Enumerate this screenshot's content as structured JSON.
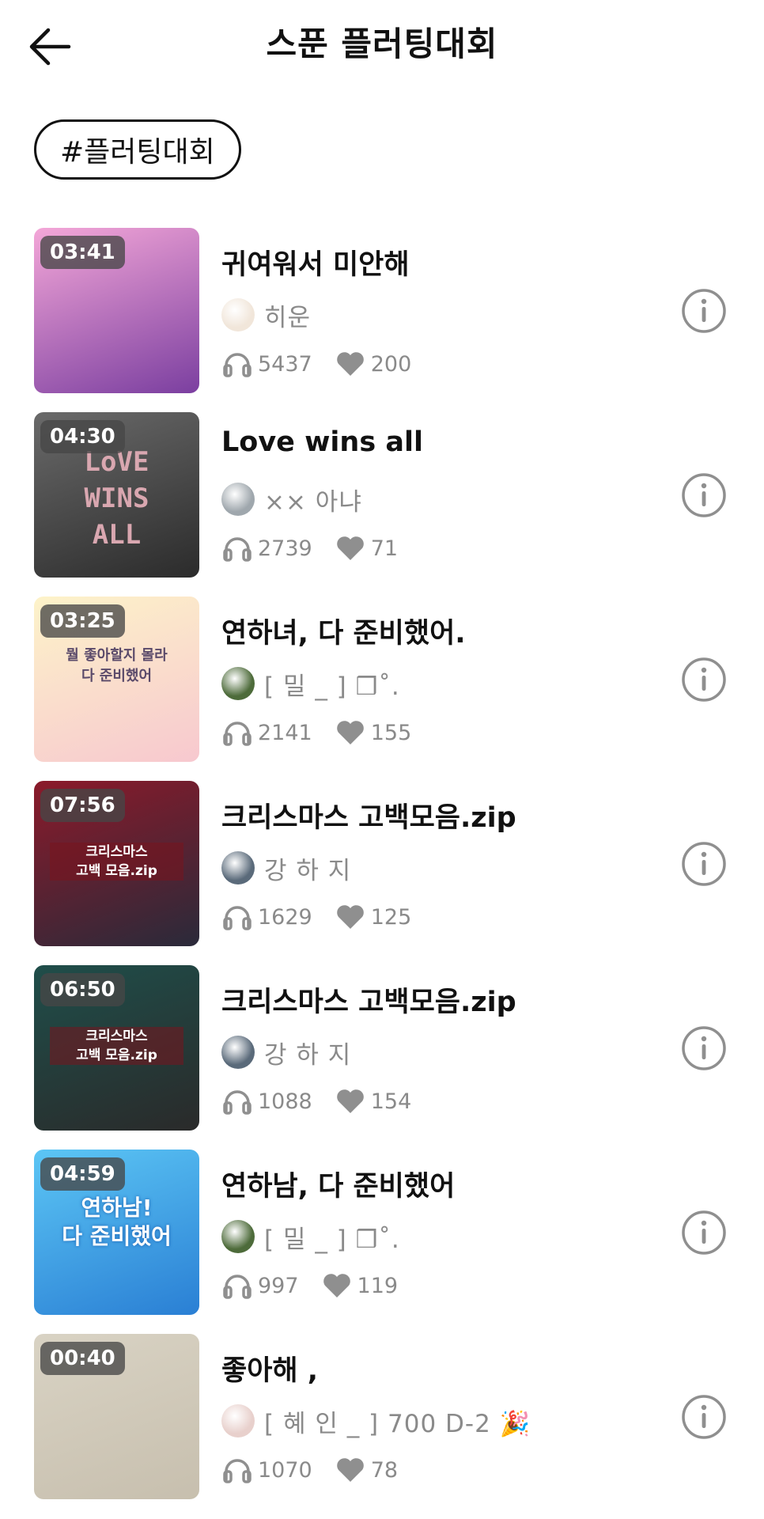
{
  "header": {
    "title": "스푼 플러팅대회"
  },
  "tag": {
    "label": "#플러팅대회"
  },
  "tracks": [
    {
      "duration": "03:41",
      "title": "귀여워서 미안해",
      "author": "히운",
      "listens": "5437",
      "likes": "200",
      "colors": {
        "thumb_a": "#f4a7d8",
        "thumb_b": "#7b3fa0",
        "avatar": "#f1e6da"
      }
    },
    {
      "duration": "04:30",
      "title": "Love wins all",
      "author": "×× 아냐",
      "listens": "2739",
      "likes": "71",
      "thumb_text": "LoVE\nWINS\nALL",
      "colors": {
        "thumb_a": "#6a6a6a",
        "thumb_b": "#2b2b2b",
        "avatar": "#9fa7ad"
      }
    },
    {
      "duration": "03:25",
      "title": "연하녀, 다 준비했어.",
      "author": "[ 밀 _ ] ❒˚.",
      "listens": "2141",
      "likes": "155",
      "thumb_text": "뭘 좋아할지 몰라\n다 준비했어",
      "colors": {
        "thumb_a": "#fdf3c9",
        "thumb_b": "#f7c8cf",
        "avatar": "#4d6b3a"
      }
    },
    {
      "duration": "07:56",
      "title": "크리스마스 고백모음.zip",
      "author": "강 하 지",
      "listens": "1629",
      "likes": "125",
      "thumb_text": "크리스마스\n고백 모음.zip",
      "colors": {
        "thumb_a": "#8b1a2a",
        "thumb_b": "#2a2a3a",
        "avatar": "#5a6a7a"
      }
    },
    {
      "duration": "06:50",
      "title": "크리스마스 고백모음.zip",
      "author": "강 하 지",
      "listens": "1088",
      "likes": "154",
      "thumb_text": "크리스마스\n고백 모음.zip",
      "colors": {
        "thumb_a": "#1f4e4a",
        "thumb_b": "#2a2a2a",
        "avatar": "#5a6a7a"
      }
    },
    {
      "duration": "04:59",
      "title": "연하남, 다 준비했어",
      "author": "[ 밀 _ ] ❒˚.",
      "listens": "997",
      "likes": "119",
      "thumb_text": "연하남!\n다 준비했어",
      "colors": {
        "thumb_a": "#5cc6f5",
        "thumb_b": "#2a7fd4",
        "avatar": "#4d6b3a"
      }
    },
    {
      "duration": "00:40",
      "title": "좋아해 ,",
      "author": "[ 혜 인 _ ] 700 D-2 🎉",
      "listens": "1070",
      "likes": "78",
      "colors": {
        "thumb_a": "#d9d3c4",
        "thumb_b": "#c7bfae",
        "avatar": "#e8d0cc"
      }
    }
  ],
  "icons": {
    "back": "back-arrow-icon",
    "listens": "headphones-icon",
    "likes": "heart-icon",
    "info": "info-icon"
  },
  "colors": {
    "text_primary": "#111111",
    "text_secondary": "#8a8a8a",
    "icon_gray": "#8f8f8f"
  }
}
